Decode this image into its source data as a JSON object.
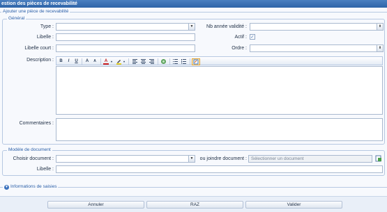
{
  "window": {
    "title": "estion des pièces de recevabilité"
  },
  "section": {
    "title": "Ajouter une pièce de recevabilité"
  },
  "general": {
    "legend": "Général",
    "type_label": "Type :",
    "type_value": "",
    "nb_annee_label": "Nb année validité :",
    "nb_annee_value": "",
    "libelle_label": "Libelle :",
    "libelle_value": "",
    "actif_label": "Actif :",
    "actif_checked": true,
    "actif_mark": "✓",
    "libelle_court_label": "Libelle court :",
    "libelle_court_value": "",
    "ordre_label": "Ordre :",
    "ordre_value": "",
    "description_label": "Description :",
    "commentaires_label": "Commentaires :",
    "toolbar": {
      "bold": "B",
      "italic": "I",
      "underline": "U",
      "font_grow": "A",
      "font_shrink": "A",
      "font_color": "A"
    }
  },
  "modele": {
    "legend": "Modèle de document",
    "choisir_label": "Choisir document :",
    "choisir_value": "",
    "joindre_label": "ou joindre document :",
    "joindre_placeholder": "Sélectionner un document",
    "libelle_label": "Libelle :",
    "libelle_value": ""
  },
  "info": {
    "label": "Informations de saisies"
  },
  "buttons": {
    "annuler": "Annuler",
    "raz": "RAZ",
    "valider": "Valider"
  },
  "icons": {
    "dropdown": "▼",
    "spinner": "⬍",
    "expand": "▼"
  },
  "colors": {
    "accent": "#2b5fa8",
    "title_bar": "#2e64a8",
    "border": "#b6c8e2"
  }
}
